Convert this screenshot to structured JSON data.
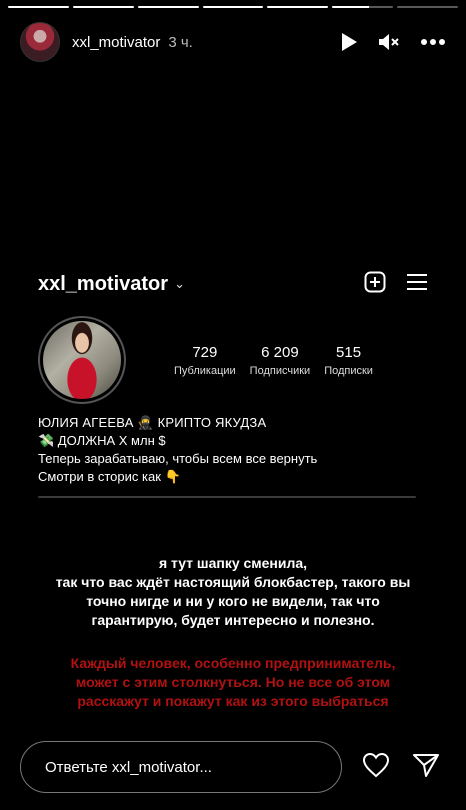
{
  "story": {
    "progress": [
      1,
      1,
      1,
      1,
      1,
      0.6,
      0
    ],
    "username": "xxl_motivator",
    "time": "3 ч."
  },
  "profile": {
    "username": "xxl_motivator",
    "stats": [
      {
        "value": "729",
        "label": "Публикации"
      },
      {
        "value": "6 209",
        "label": "Подписчики"
      },
      {
        "value": "515",
        "label": "Подписки"
      }
    ],
    "bio": {
      "name": "ЮЛИЯ АГЕЕВА 🥷 КРИПТО ЯКУДЗА",
      "line1": "💸 ДОЛЖНА Х млн $",
      "line2": "Теперь зарабатываю, чтобы всем все вернуть",
      "line3": "Смотри в сторис как 👇"
    }
  },
  "captions": {
    "white": [
      "я тут шапку сменила,",
      "так что вас ждёт настоящий блокбастер, такого вы",
      "точно нигде и ни у кого не видели, так что",
      "гарантирую, будет интересно и полезно."
    ],
    "red": [
      "Каждый человек, особенно предприниматель,",
      "может с этим столкнуться. Но не все об этом",
      "расскажут и покажут как из этого выбраться"
    ]
  },
  "footer": {
    "reply_placeholder": "Ответьте xxl_motivator..."
  },
  "icons": {
    "play": "play-icon",
    "mute": "mute-icon",
    "more": "more-icon",
    "add": "add-square-icon",
    "menu": "hamburger-menu-icon",
    "heart": "heart-icon",
    "send": "send-icon"
  }
}
